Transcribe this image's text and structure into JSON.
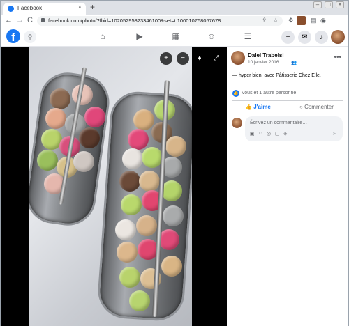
{
  "browser": {
    "tab_title": "Facebook",
    "tab_close": "×",
    "new_tab": "+",
    "url": "facebook.com/photo/?fbid=10205295823346100&set=t.100010768057678",
    "back": "←",
    "forward": "→",
    "reload": "C"
  },
  "header": {
    "logo": "f",
    "nav_icons": [
      "home-icon",
      "watch-icon",
      "marketplace-icon",
      "groups-icon",
      "menu-icon"
    ],
    "right_buttons": [
      "+",
      "messenger-icon",
      "bell-icon"
    ]
  },
  "post": {
    "author": "Dalel Trabelsi",
    "date": "10 janvier 2016",
    "text": "— hyper bien, avec Pâtisserie Chez Elle.",
    "reactions": "Vous et 1 autre personne",
    "like_label": "J'aime",
    "comment_label": "Commenter",
    "comment_placeholder": "Écrivez un commentaire…"
  },
  "colors": {
    "brand": "#1877f2",
    "panel_bg": "#ffffff",
    "photo_bg": "#000000"
  }
}
